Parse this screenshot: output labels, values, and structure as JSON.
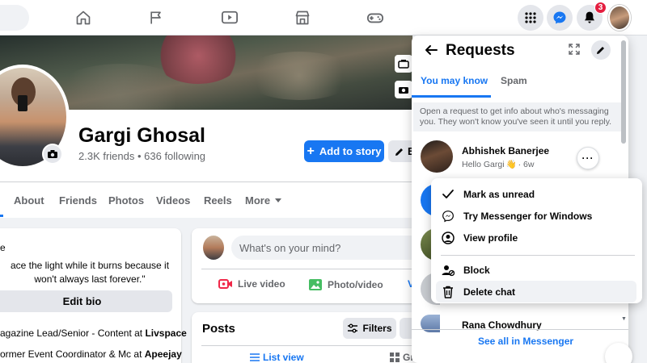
{
  "topnav": {
    "notification_count": "3",
    "icons": [
      "home-icon",
      "pages-flag-icon",
      "watch-icon",
      "marketplace-icon",
      "gaming-icon",
      "menu-grid-icon",
      "messenger-icon",
      "bell-icon"
    ]
  },
  "profile": {
    "name": "Gargi Ghosal",
    "friends": "2.3K friends • 636 following",
    "add_story_label": "Add to story",
    "edit_label": "E"
  },
  "tabs": [
    "About",
    "Friends",
    "Photos",
    "Videos",
    "Reels",
    "More"
  ],
  "intro": {
    "dot_text": "e",
    "quote": "ace the light while it burns because it won't always last forever.\"",
    "edit_bio_label": "Edit bio",
    "line1_text": "agazine Lead/Senior - Content at ",
    "line1_bold": "Livspace",
    "line2_text": "ormer Event Coordinator & Mc at ",
    "line2_bold": "Apeejay"
  },
  "composer": {
    "placeholder": "What's on your mind?",
    "live_video": "Live video",
    "photo_video": "Photo/video",
    "extra": "V"
  },
  "posts": {
    "title": "Posts",
    "filters_label": "Filters",
    "list_view": "List view",
    "grid_view": "Grid view"
  },
  "requests": {
    "title": "Requests",
    "tab_active": "You may know",
    "tab_inactive": "Spam",
    "info": "Open a request to get info about who's messaging you. They won't know you've seen it until you reply.",
    "item1_name": "Abhishek Banerjee",
    "item1_preview": "Hello Gargi",
    "item1_time": "· 6w",
    "more_label": "···",
    "item2_name": "Rana Chowdhury",
    "see_all": "See all in Messenger"
  },
  "menu": {
    "items": [
      "Mark as unread",
      "Try Messenger for Windows",
      "View profile",
      "Block",
      "Delete chat"
    ]
  },
  "colors": {
    "accent": "#1877f2",
    "badge": "#e41e3f"
  }
}
